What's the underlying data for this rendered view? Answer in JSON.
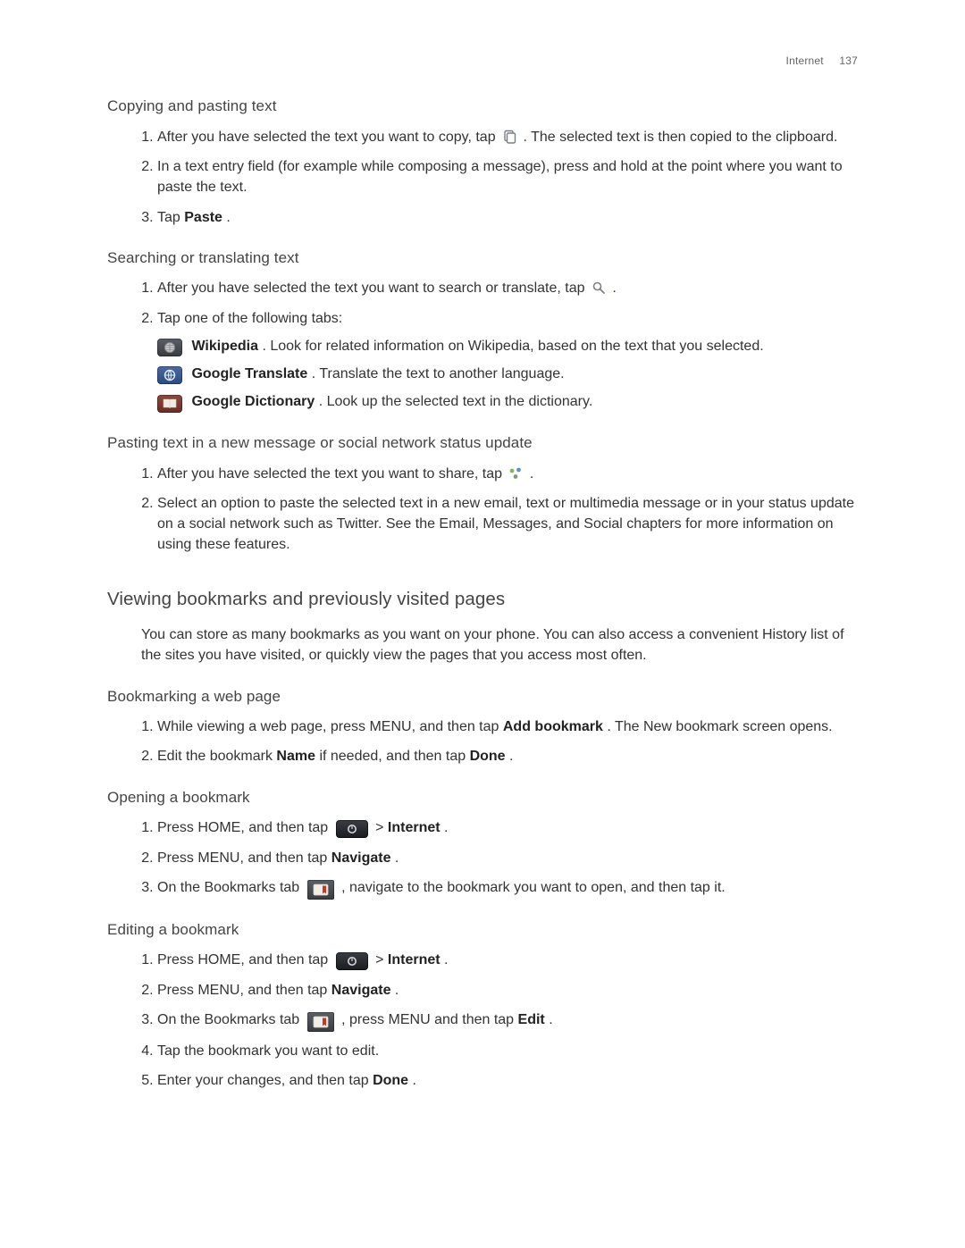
{
  "header": {
    "section": "Internet",
    "page": "137"
  },
  "h_copy": "Copying and pasting text",
  "copy_steps": {
    "s1a": "After you have selected the text you want to copy, tap ",
    "s1b": ". The selected text is then copied to the clipboard.",
    "s2": "In a text entry field (for example while composing a message), press and hold at the point where you want to paste the text.",
    "s3a": "Tap ",
    "s3_bold": "Paste",
    "s3b": "."
  },
  "h_search": "Searching or translating text",
  "search_steps": {
    "s1a": "After you have selected the text you want to search or translate, tap ",
    "s1b": ".",
    "s2": "Tap one of the following tabs:",
    "opt1_bold": "Wikipedia",
    "opt1_text": ". Look for related information on Wikipedia, based on the text that you selected.",
    "opt2_bold": "Google Translate",
    "opt2_text": ". Translate the text to another language.",
    "opt3_bold": "Google Dictionary",
    "opt3_text": ". Look up the selected text in the dictionary."
  },
  "h_paste": "Pasting text in a new message or social network status update",
  "paste_steps": {
    "s1a": "After you have selected the text you want to share, tap ",
    "s1b": ".",
    "s2": "Select an option to paste the selected text in a new email, text or multimedia message or in your status update on a social network such as Twitter. See the Email, Messages, and Social chapters for more information on using these features."
  },
  "h_view": "Viewing bookmarks and previously visited pages",
  "view_intro": "You can store as many bookmarks as you want on your phone. You can also access a convenient History list of the sites you have visited, or quickly view the pages that you access most often.",
  "h_bookmark": "Bookmarking a web page",
  "bookmark_steps": {
    "s1a": "While viewing a web page, press MENU, and then tap ",
    "s1_bold": "Add bookmark",
    "s1b": ". The New bookmark screen opens.",
    "s2a": "Edit the bookmark ",
    "s2_bold1": "Name",
    "s2b": " if needed, and then tap ",
    "s2_bold2": "Done",
    "s2c": "."
  },
  "h_open": "Opening a bookmark",
  "open_steps": {
    "s1a": "Press HOME, and then tap ",
    "s1_sep": " > ",
    "s1_bold": "Internet",
    "s1b": ".",
    "s2a": "Press MENU, and then tap ",
    "s2_bold": "Navigate",
    "s2b": ".",
    "s3a": "On the Bookmarks tab ",
    "s3b": ", navigate to the bookmark you want to open, and then tap it."
  },
  "h_edit": "Editing a bookmark",
  "edit_steps": {
    "s1a": "Press HOME, and then tap ",
    "s1_sep": " > ",
    "s1_bold": "Internet",
    "s1b": ".",
    "s2a": "Press MENU, and then tap ",
    "s2_bold": "Navigate",
    "s2b": ".",
    "s3a": "On the Bookmarks tab ",
    "s3b": ", press MENU and then tap ",
    "s3_bold": "Edit",
    "s3c": ".",
    "s4": "Tap the bookmark you want to edit.",
    "s5a": "Enter your changes, and then tap ",
    "s5_bold": "Done",
    "s5b": "."
  }
}
